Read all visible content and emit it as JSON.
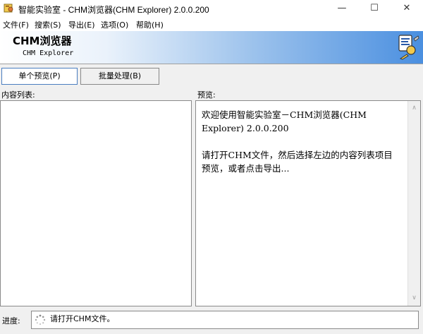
{
  "window": {
    "title": "智能实验室 - CHM浏览器(CHM Explorer) 2.0.0.200",
    "minimize_icon": "minimize-icon",
    "maximize_icon": "maximize-icon",
    "close_icon": "close-icon"
  },
  "menu": {
    "items": [
      {
        "label": "文件(F)"
      },
      {
        "label": "搜索(S)"
      },
      {
        "label": "导出(E)"
      },
      {
        "label": "选项(O)"
      },
      {
        "label": "帮助(H)"
      }
    ]
  },
  "banner": {
    "title": "CHM浏览器",
    "subtitle": "CHM Explorer",
    "logo_icon": "tools-logo-icon"
  },
  "tabs": [
    {
      "label": "单个预览(P)",
      "active": true
    },
    {
      "label": "批量处理(B)",
      "active": false
    }
  ],
  "content_list": {
    "label": "内容列表:"
  },
  "preview": {
    "label": "预览:",
    "lines": [
      "欢迎使用智能实验室－CHM浏览器(CHM Explorer) 2.0.0.200",
      "请打开CHM文件，然后选择左边的内容列表项目预览，或者点击导出..."
    ]
  },
  "progress": {
    "label": "进度:",
    "status_text": "请打开CHM文件。",
    "icon": "loading-spinner-icon"
  },
  "colors": {
    "banner_gradient_end": "#4a8fe0",
    "active_tab_border": "#4a7ec0"
  }
}
